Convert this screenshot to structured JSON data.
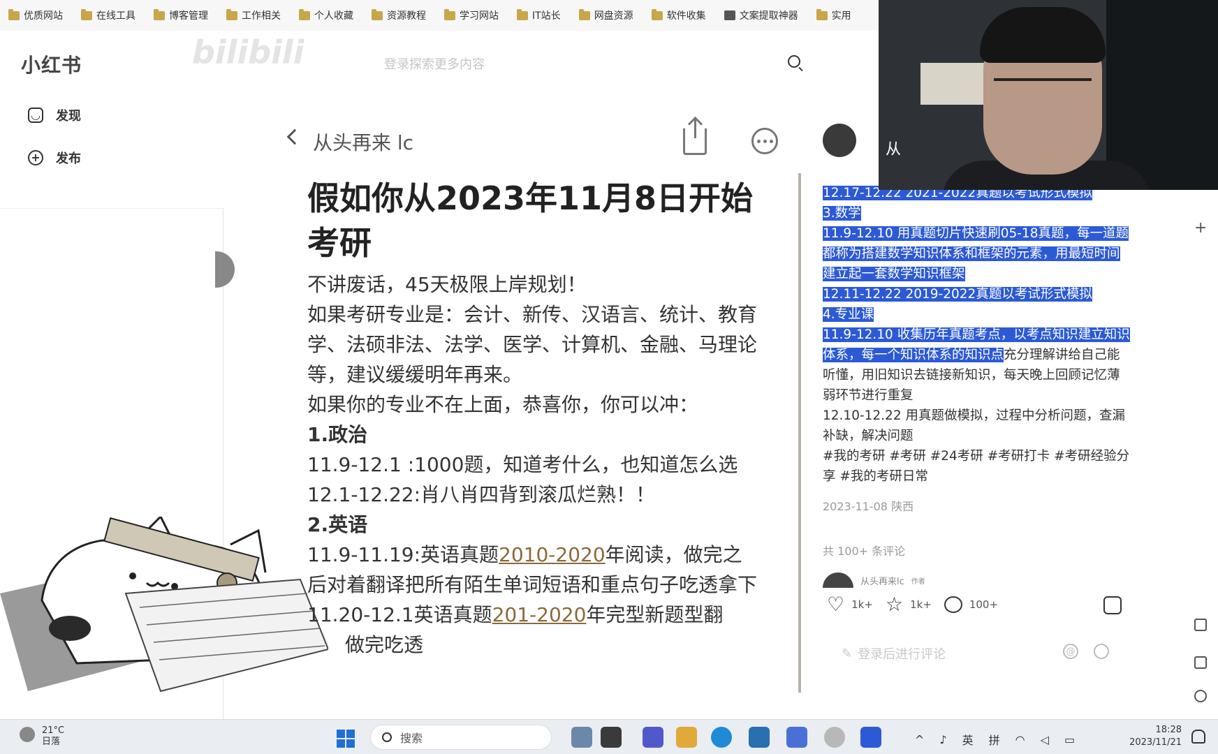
{
  "bookmarks": [
    "优质网站",
    "在线工具",
    "博客管理",
    "工作相关",
    "个人收藏",
    "资源教程",
    "学习网站",
    "IT站长",
    "网盘资源",
    "软件收集",
    "文案提取神器",
    "实用"
  ],
  "header": {
    "logo": "小红书",
    "watermark": "bilibili",
    "search_placeholder": "登录探索更多内容"
  },
  "nav": {
    "discover": "发现",
    "publish": "发布"
  },
  "note": {
    "author": "从头再来 lc",
    "title": "假如你从2023年11月8日开始考研",
    "lines": [
      "不讲废话，45天极限上岸规划！",
      "如果考研专业是：会计、新传、汉语言、统计、教育学、法硕非法、法学、医学、计算机、金融、马理论等，建议缓缓明年再来。",
      "如果你的专业不在上面，恭喜你，你可以冲：",
      "1.政治",
      "11.9-12.1 :1000题，知道考什么，也知道怎么选",
      "12.1-12.22:肖八肖四背到滚瓜烂熟！！",
      "2.英语",
      "11.9-11.19:英语真题",
      "2010-2020",
      "年阅读，做完之后对着翻译把所有陌生单词短语和重点句子吃透拿下",
      "11.20-12.1英语真题",
      "201-2020",
      "年完型新题型翻",
      "做完吃透"
    ]
  },
  "side": {
    "author_short": "从",
    "highlighted": [
      "12.17-12.22 2021-2022真题以考试形式模拟",
      "3.数学",
      "11.9-12.10 用真题切片快速刷05-18真题，每一道题都称为搭建数学知识体系和框架的元素，用最短时间建立起一套数学知识框架",
      "12.11-12.22 2019-2022真题以考试形式模拟",
      "4.专业课",
      "11.9-12.10 收集历年真题考点，以考点知识建立知识体系，每一个知识体系的知识点"
    ],
    "plain_after": "充分理解讲给自己能听懂，用旧知识去链接新知识，每天晚上回顾记忆薄弱环节进行重复",
    "plain_line2": "12.10-12.22 用真题做模拟，过程中分析问题，查漏补缺，解决问题",
    "tags": "#我的考研 #考研 #24考研 #考研打卡 #考研经验分享 #我的考研日常",
    "date_loc": "2023-11-08 陕西",
    "comments_total": "共 100+ 条评论",
    "comment_author": "从头再来lc",
    "comment_author_badge": "作者",
    "likes": "1k+",
    "collects": "1k+",
    "comments": "100+",
    "comment_placeholder": "登录后进行评论"
  },
  "taskbar": {
    "temp": "21°C",
    "weather": "日落",
    "search": "搜索",
    "ime_lang": "英",
    "ime_mode": "拼",
    "time": "18:28",
    "date": "2023/11/21"
  },
  "colors": {
    "highlight": "#2c5ad6",
    "link": "#8a6a3a",
    "windows_blue": "#1f6fd6"
  }
}
